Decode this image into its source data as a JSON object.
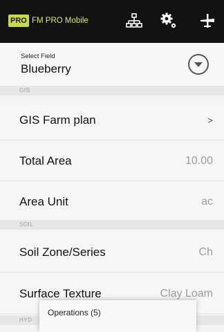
{
  "app": {
    "logo": "PRO",
    "title": "FM PRO Mobile"
  },
  "toolbar": {
    "icons": [
      "network-icon",
      "settings-icon",
      "sync-icon"
    ]
  },
  "field": {
    "label": "Select Field",
    "value": "Blueberry"
  },
  "sections": {
    "gis": "GIS",
    "soil": "SOIL",
    "hyd": "HYD"
  },
  "rows": {
    "gis_farm_plan": {
      "label": "GIS Farm plan",
      "value": ">"
    },
    "total_area": {
      "label": "Total Area",
      "value": "10.00"
    },
    "area_unit": {
      "label": "Area Unit",
      "value": "ac"
    },
    "soil_zone": {
      "label": "Soil Zone/Series",
      "value": "Ch"
    },
    "surface_texture": {
      "label": "Surface Texture",
      "value": "Clay Loam"
    }
  },
  "popup": {
    "label": "Operations (5)"
  },
  "colors": {
    "topbar": "#121212",
    "logo_bg": "#c8d94b",
    "title": "#d8e77a"
  }
}
